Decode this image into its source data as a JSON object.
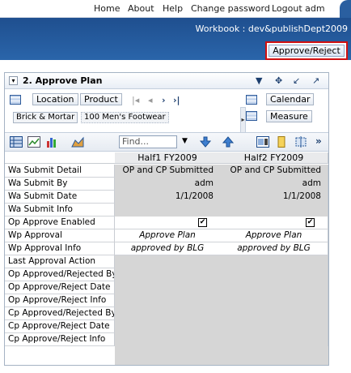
{
  "nav": {
    "home": "Home",
    "about": "About",
    "help": "Help",
    "change_password": "Change password",
    "logout": "Logout adm"
  },
  "workbook": {
    "title": "Workbook : dev&publishDept2009",
    "approve_button": "Approve/Reject"
  },
  "panel": {
    "title": "2. Approve Plan",
    "dims_left": [
      "Location",
      "Product"
    ],
    "dims_right": [
      "Calendar",
      "Measure"
    ],
    "crumbs": [
      "Brick & Mortar",
      "100 Men's Footwear"
    ],
    "find_placeholder": "Find..."
  },
  "grid": {
    "columns": [
      "Half1 FY2009",
      "Half2 FY2009"
    ],
    "rows": [
      {
        "label": "Wa Submit Detail",
        "values": [
          "OP and CP Submitted",
          "OP and CP Submitted"
        ],
        "style": "gray"
      },
      {
        "label": "Wa Submit By",
        "values": [
          "adm",
          "adm"
        ],
        "style": "gray"
      },
      {
        "label": "Wa Submit Date",
        "values": [
          "1/1/2008",
          "1/1/2008"
        ],
        "style": "gray"
      },
      {
        "label": "Wa Submit Info",
        "values": [
          "",
          ""
        ],
        "style": "gray"
      },
      {
        "label": "Op Approve Enabled",
        "values": [
          "checked",
          "checked"
        ],
        "style": "checkbox"
      },
      {
        "label": "Wp Approval",
        "values": [
          "Approve Plan",
          "Approve Plan"
        ],
        "style": "italic"
      },
      {
        "label": "Wp Approval Info",
        "values": [
          "approved by BLG",
          "approved by BLG"
        ],
        "style": "italic"
      },
      {
        "label": "Last Approval Action",
        "values": [
          "",
          ""
        ],
        "style": "gray"
      },
      {
        "label": "Op Approved/Rejected By",
        "values": [
          "",
          ""
        ],
        "style": "gray"
      },
      {
        "label": "Op Approve/Reject Date",
        "values": [
          "",
          ""
        ],
        "style": "gray"
      },
      {
        "label": "Op Approve/Reject Info",
        "values": [
          "",
          ""
        ],
        "style": "gray"
      },
      {
        "label": "Cp Approved/Rejected By",
        "values": [
          "",
          ""
        ],
        "style": "gray"
      },
      {
        "label": "Cp Approve/Reject Date",
        "values": [
          "",
          ""
        ],
        "style": "gray"
      },
      {
        "label": "Cp Approve/Reject Info",
        "values": [
          "",
          ""
        ],
        "style": "gray"
      }
    ]
  },
  "colors": {
    "band": "#1f4f8f",
    "highlight": "#d01010",
    "cell_gray": "#d6d6d6"
  }
}
